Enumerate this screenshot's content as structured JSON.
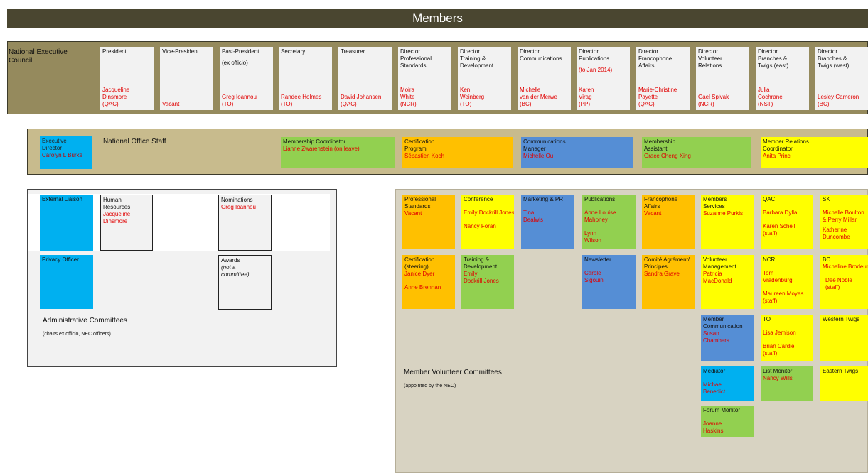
{
  "title": "Members",
  "nec": {
    "label": "National  Executive\nCouncil",
    "cards": [
      {
        "title": "President",
        "note": "",
        "name": "Jacqueline\nDinsmore\n(QAC)"
      },
      {
        "title": "Vice-President",
        "note": "",
        "name": "Vacant"
      },
      {
        "title": "Past-President",
        "note": "(ex officio)",
        "name": "Greg Ioannou\n(TO)"
      },
      {
        "title": "Secretary",
        "note": "",
        "name": "Randee Holmes\n(TO)"
      },
      {
        "title": "Treasurer",
        "note": "",
        "name": "David Johansen\n(QAC)"
      },
      {
        "title": "Director\nProfessional\nStandards",
        "note": "",
        "name": "Moira\nWhite\n(NCR)"
      },
      {
        "title": "Director\nTraining &\nDevelopment",
        "note": "",
        "name": "Ken\nWeinberg\n(TO)"
      },
      {
        "title": "Director\nCommunications",
        "note": "",
        "name": "Michelle\nvan der Merwe\n(BC)"
      },
      {
        "title": "Director\nPublications",
        "note": "(to Jan 2014)",
        "name": "Karen\nVirag\n(PP)"
      },
      {
        "title": "Director\nFrancophone\nAffairs",
        "note": "",
        "name": "Marie-Christine\nPayette\n(QAC)"
      },
      {
        "title": "Director\nVolunteer\nRelations",
        "note": "",
        "name": "Gael Spivak\n(NCR)"
      },
      {
        "title": "Director\nBranches &\nTwigs (east)",
        "note": "",
        "name": "Julia\nCochrane\n(NST)"
      },
      {
        "title": "Director\nBranches &\nTwigs (west)",
        "note": "",
        "name": "Lesley Cameron\n(BC)"
      }
    ]
  },
  "staff": {
    "label": "National  Office Staff",
    "ed_title": "Executive\nDirector",
    "ed_name": "Carolyn L Burke",
    "boxes": [
      {
        "title": "Membership Coordinator",
        "name": "Lianne Zwarenstein (on leave)"
      },
      {
        "title": "Certification\nProgram",
        "name": "Sébastien Koch"
      },
      {
        "title": "Communications\nManager",
        "name": "Michelle Ou"
      },
      {
        "title": "Membership\nAssistant",
        "name": "Grace Cheng Xing"
      },
      {
        "title": "Member Relations\nCoordinator",
        "name": "Anita Princl"
      }
    ]
  },
  "admin": {
    "label": "Administrative  Committees",
    "sub": "(chairs ex officio, NEC officers)",
    "external": "External Liaison",
    "privacy": "Privacy Officer",
    "hr_title": "Human\nResources",
    "hr_name": "Jacqueline\nDinsmore",
    "nom_title": "Nominations",
    "nom_name": "Greg Ioannou",
    "awards_title": "Awards",
    "awards_note": "(not a\ncommittee)"
  },
  "mvc": {
    "label": "Member  Volunteer Committees",
    "sub": "(appointed by the NEC)",
    "ps_title": "Professional\nStandards",
    "ps_name": "Vacant",
    "conf_title": "Conference",
    "conf_n1": "Emily Dockrill Jones",
    "conf_n2": "Nancy Foran",
    "mpr_title": "Marketing & PR",
    "mpr_name": "Tina\nDealwis",
    "pub_title": "Publications",
    "pub_n1": "Anne Louise\nMahoney",
    "pub_n2": "Lynn\nWilson",
    "fa_title": "Francophone\nAffairs",
    "fa_name": "Vacant",
    "ms_title": "Members\nServices",
    "ms_name": "Suzanne Purkis",
    "qac_title": "QAC",
    "qac_n1": "Barbara Dylla",
    "qac_n2": "Karen Schell\n(staff)",
    "sk_title": "SK",
    "sk_n1": "Michelle Boulton\n& Perry Millar",
    "sk_n2": "Katherine\nDuncombe",
    "cs_title": "Certification\n(steering)",
    "cs_n1": "Janice Dyer",
    "cs_n2": "Anne Brennan",
    "td_title": "Training &\nDevelopment",
    "td_name": "Emily\nDockrill Jones",
    "nl_title": "Newsletter",
    "nl_name": "Carole\nSigouin",
    "ca_title": "Comité Agrément/\nPrincipes",
    "ca_name": "Sandra Gravel",
    "vm_title": "Volunteer\nManagement",
    "vm_name": "Patricia MacDonald",
    "ncr_title": "NCR",
    "ncr_n1": "Tom\nVradenburg",
    "ncr_n2": "Maureen Moyes\n(staff)",
    "bc_title": "BC",
    "bc_n1": "Micheline Brodeur",
    "bc_n2": "Dee Noble\n(staff)",
    "mc_title": "Member\nCommunication",
    "mc_name": "Susan\nChambers",
    "to_title": "TO",
    "to_n1": "Lisa Jemison",
    "to_n2": "Brian Cardie\n(staff)",
    "wt_title": "Western Twigs",
    "med_title": "Mediator",
    "med_name": "Michael\nBenedict",
    "lm_title": "List Monitor",
    "lm_name": "Nancy Wills",
    "et_title": "Eastern Twigs",
    "fm_title": "Forum Monitor",
    "fm_name": "Joanne\nHaskins"
  },
  "colors": {
    "banner": "#4a4630",
    "nec_panel": "#958a5d",
    "staff_panel": "#c8bb8d",
    "yellow": "#ffff00",
    "orange": "#ffc000",
    "green": "#92d050",
    "blue": "#558ed5",
    "cyan": "#00b0f0",
    "name_red": "#e00000"
  }
}
